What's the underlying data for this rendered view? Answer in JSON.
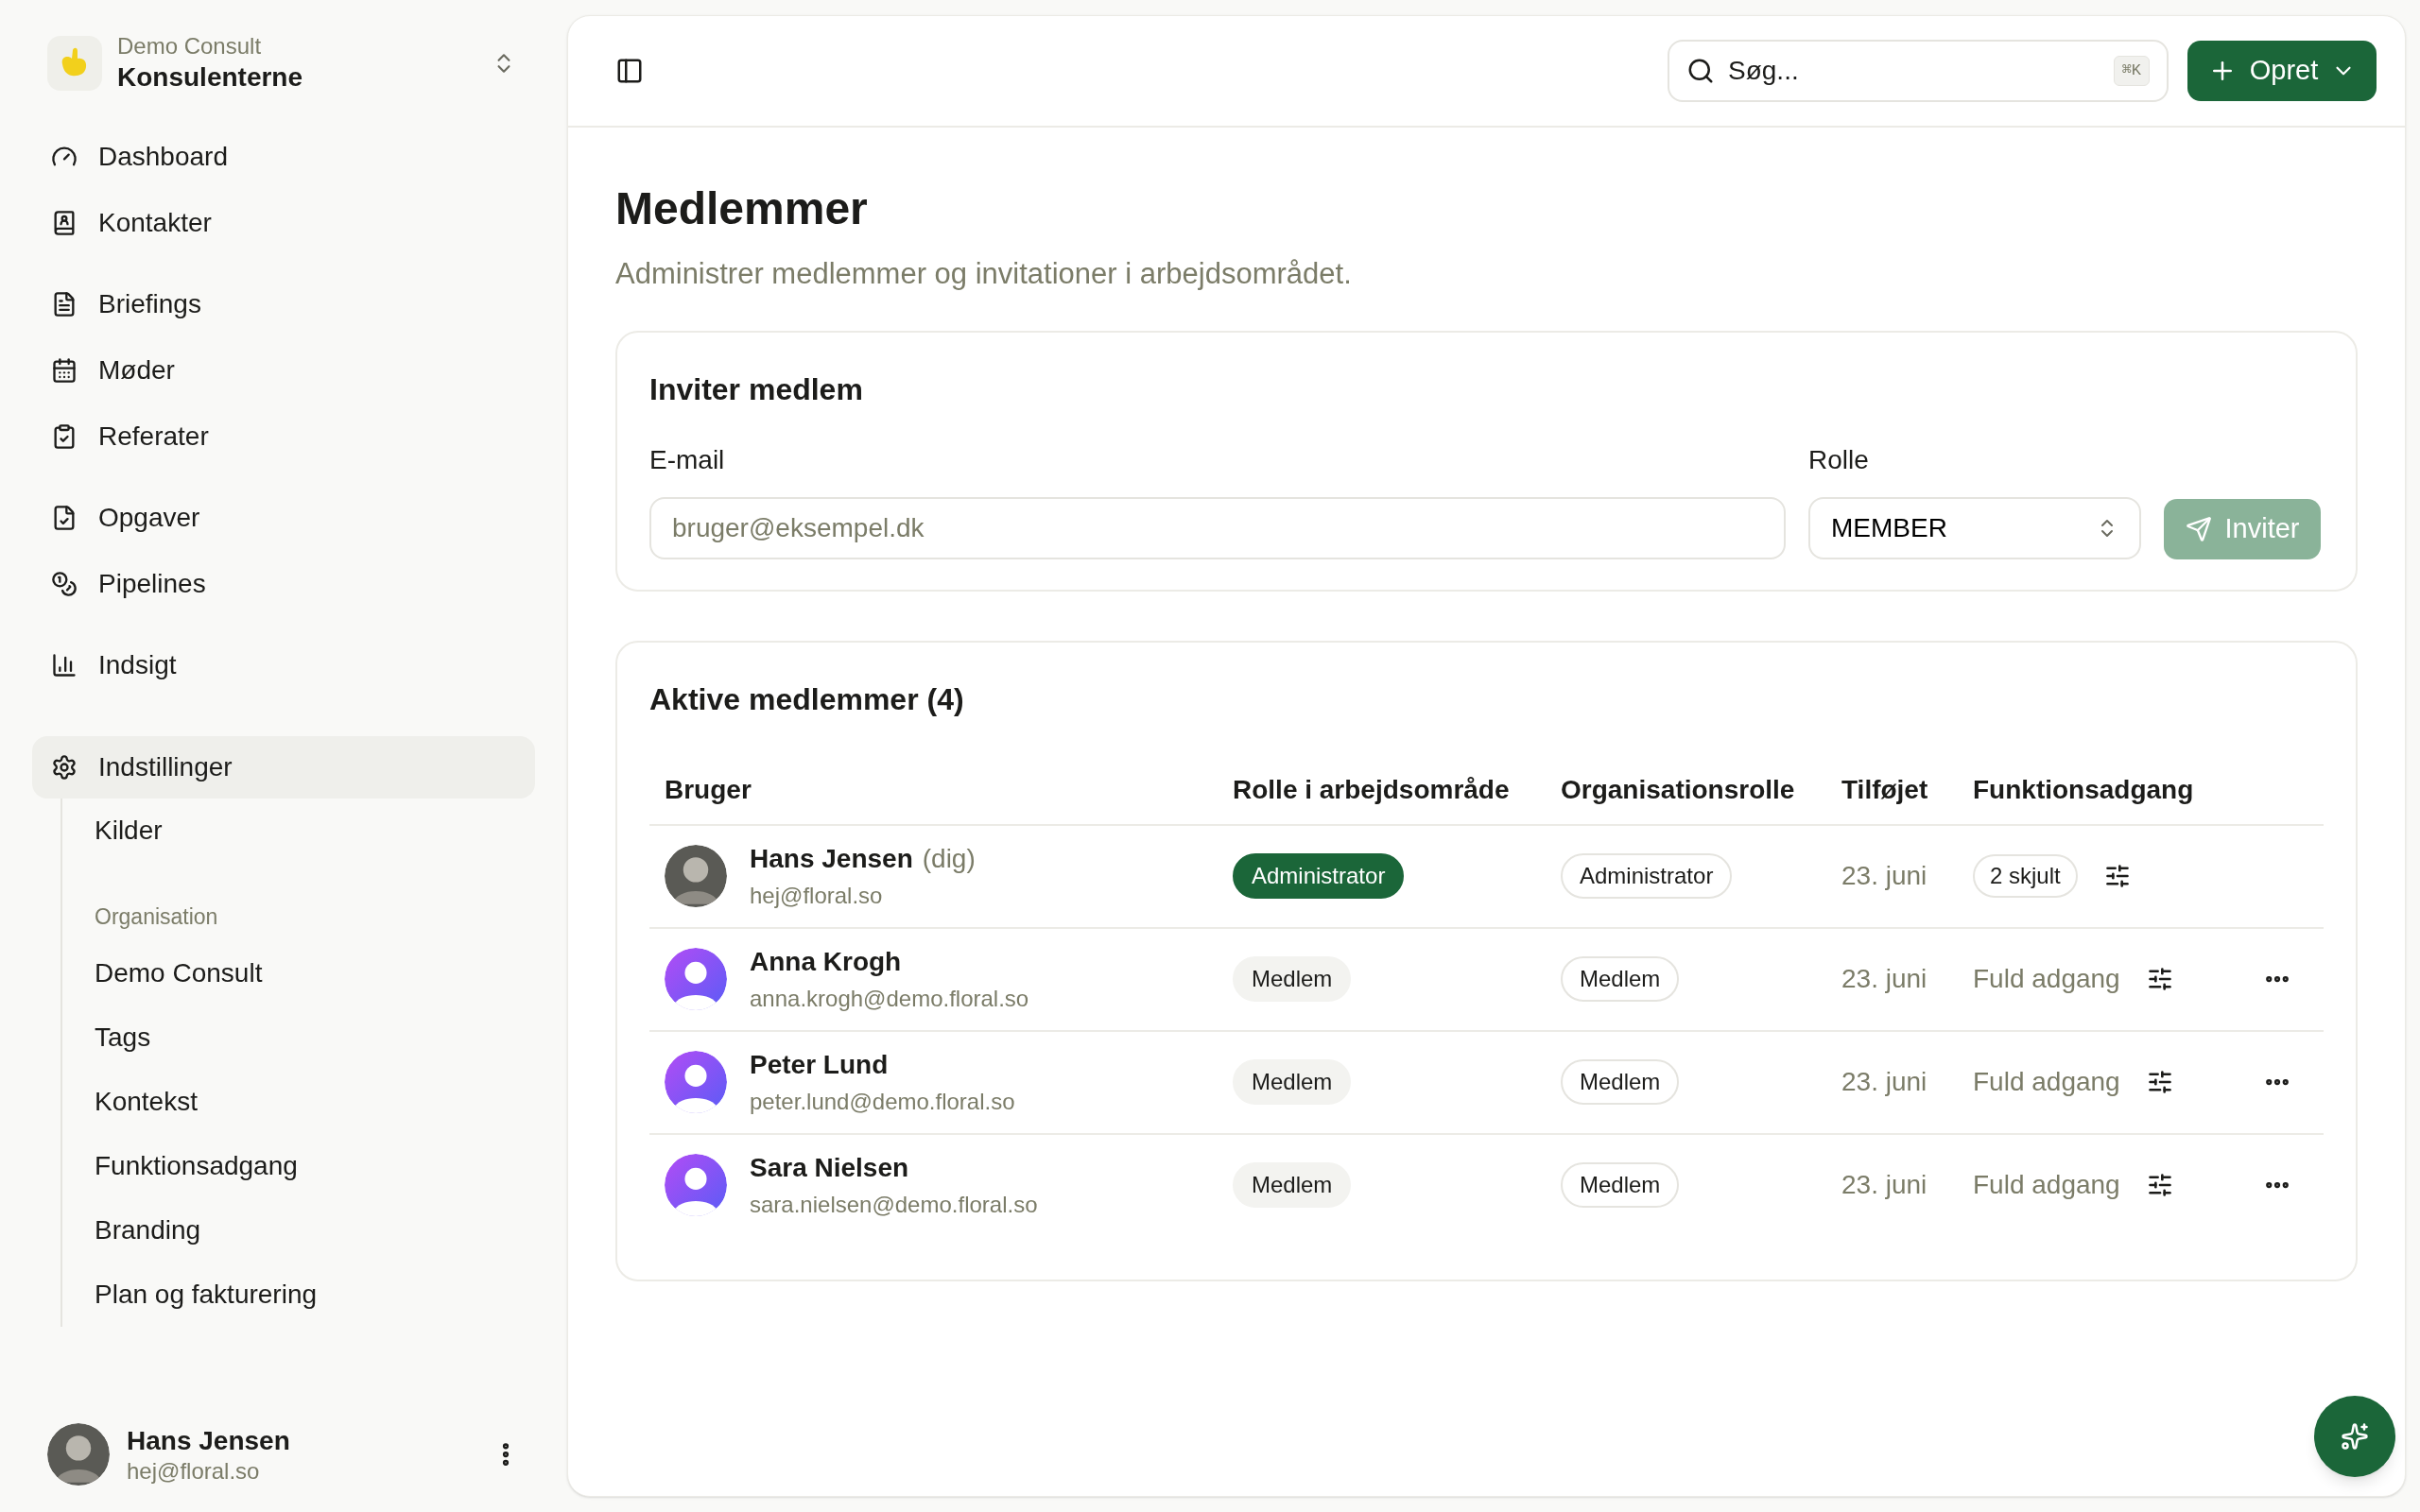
{
  "workspace": {
    "organisation": "Demo Consult",
    "name": "Konsulenterne"
  },
  "nav_groups": [
    [
      {
        "label": "Dashboard",
        "selected": false
      },
      {
        "label": "Kontakter",
        "selected": false
      }
    ],
    [
      {
        "label": "Briefings",
        "selected": false
      },
      {
        "label": "Møder",
        "selected": false
      },
      {
        "label": "Referater",
        "selected": false
      }
    ],
    [
      {
        "label": "Opgaver",
        "selected": false
      },
      {
        "label": "Pipelines",
        "selected": false
      }
    ],
    [
      {
        "label": "Indsigt",
        "selected": false
      }
    ]
  ],
  "settings": {
    "label": "Indstillinger",
    "selected": true,
    "expanded": true,
    "children": [
      {
        "kind": "link",
        "label": "Kilder",
        "selected": false
      },
      {
        "kind": "heading",
        "label": "Organisation"
      },
      {
        "kind": "link",
        "label": "Demo Consult",
        "selected": false
      },
      {
        "kind": "link",
        "label": "Tags",
        "selected": false
      },
      {
        "kind": "link",
        "label": "Kontekst",
        "selected": false
      },
      {
        "kind": "link",
        "label": "Funktionsadgang",
        "selected": false
      },
      {
        "kind": "link",
        "label": "Branding",
        "selected": false
      },
      {
        "kind": "link",
        "label": "Plan og fakturering",
        "selected": false
      }
    ]
  },
  "user": {
    "name": "Hans Jensen",
    "email": "hej@floral.so"
  },
  "topbar": {
    "search_placeholder": "Søg...",
    "shortcut": "⌘K",
    "create_button": "Opret"
  },
  "page": {
    "title": "Medlemmer",
    "subtitle": "Administrer medlemmer og invitationer i arbejdsområdet."
  },
  "invite": {
    "title": "Inviter medlem",
    "email_label": "E-mail",
    "email_placeholder": "bruger@eksempel.dk",
    "role_label": "Rolle",
    "role_value": "MEMBER",
    "button": "Inviter",
    "button_disabled": true
  },
  "members": {
    "title": "Aktive medlemmer (4)",
    "columns": [
      "Bruger",
      "Rolle i arbejdsområde",
      "Organisationsrolle",
      "Tilføjet",
      "Funktionsadgang"
    ],
    "rows": [
      {
        "name": "Hans Jensen",
        "suffix": "(dig)",
        "email": "hej@floral.so",
        "avatar": {
          "kind": "photo"
        },
        "workspace_role": {
          "label": "Administrator",
          "kind": "primary"
        },
        "org_role": "Administrator",
        "added": "23. juni",
        "access": {
          "kind": "badge",
          "label": "2 skjult"
        },
        "has_menu": false
      },
      {
        "name": "Anna Krogh",
        "email": "anna.krogh@demo.floral.so",
        "avatar": {
          "kind": "default"
        },
        "workspace_role": {
          "label": "Medlem",
          "kind": "muted"
        },
        "org_role": "Medlem",
        "added": "23. juni",
        "access": {
          "kind": "text",
          "label": "Fuld adgang"
        },
        "has_menu": true
      },
      {
        "name": "Peter Lund",
        "email": "peter.lund@demo.floral.so",
        "avatar": {
          "kind": "default"
        },
        "workspace_role": {
          "label": "Medlem",
          "kind": "muted"
        },
        "org_role": "Medlem",
        "added": "23. juni",
        "access": {
          "kind": "text",
          "label": "Fuld adgang"
        },
        "has_menu": true
      },
      {
        "name": "Sara Nielsen",
        "email": "sara.nielsen@demo.floral.so",
        "avatar": {
          "kind": "default"
        },
        "workspace_role": {
          "label": "Medlem",
          "kind": "muted"
        },
        "org_role": "Medlem",
        "added": "23. juni",
        "access": {
          "kind": "text",
          "label": "Fuld adgang"
        },
        "has_menu": true
      }
    ]
  }
}
